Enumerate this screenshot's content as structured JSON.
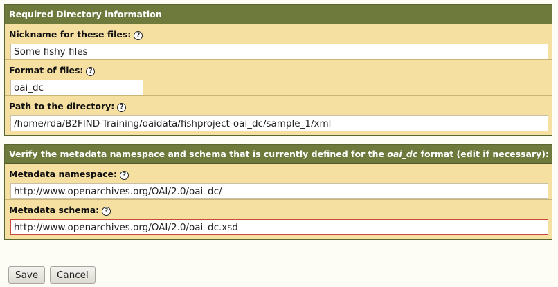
{
  "directory_panel": {
    "header": "Required Directory information",
    "nickname": {
      "label": "Nickname for these files:",
      "value": "Some fishy files"
    },
    "format": {
      "label": "Format of files:",
      "value": "oai_dc"
    },
    "path": {
      "label": "Path to the directory:",
      "value": "/home/rda/B2FIND-Training/oaidata/fishproject-oai_dc/sample_1/xml"
    }
  },
  "metadata_panel": {
    "header_prefix": "Verify the metadata namespace and schema that is currently defined for the ",
    "header_format": "oai_dc",
    "header_suffix": " format (edit if necessary):",
    "namespace": {
      "label": "Metadata namespace:",
      "value": "http://www.openarchives.org/OAI/2.0/oai_dc/"
    },
    "schema": {
      "label": "Metadata schema:",
      "value": "http://www.openarchives.org/OAI/2.0/oai_dc.xsd"
    }
  },
  "help_glyph": "?",
  "actions": {
    "save_label": "Save",
    "cancel_label": "Cancel"
  },
  "colors": {
    "header_bg": "#6d7a3c",
    "panel_bg": "#f5dfa1",
    "focus_border": "#c94a3a"
  }
}
